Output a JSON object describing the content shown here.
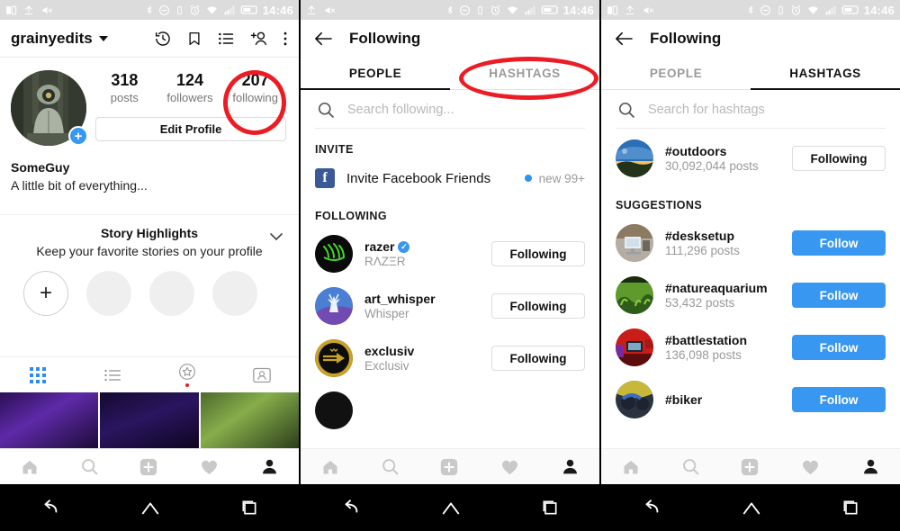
{
  "status_bar": {
    "time": "14:46",
    "icons": [
      "split-screen-icon",
      "upload-icon",
      "mute-icon",
      "bluetooth-icon",
      "dnd-icon",
      "vibrate-icon",
      "alarm-icon",
      "wifi-icon",
      "signal-icon",
      "battery-icon"
    ]
  },
  "panel1": {
    "header": {
      "username": "grainyedits",
      "icons": [
        "history-icon",
        "bookmark-icon",
        "list-icon",
        "add-person-icon",
        "more-vertical-icon"
      ]
    },
    "profile": {
      "avatar_alt": "profile-photo",
      "add_story_label": "+",
      "stats": [
        {
          "number": "318",
          "label": "posts"
        },
        {
          "number": "124",
          "label": "followers"
        },
        {
          "number": "207",
          "label": "following"
        }
      ],
      "edit_profile_label": "Edit Profile",
      "display_name": "SomeGuy",
      "bio": "A little bit of everything..."
    },
    "highlights": {
      "title": "Story Highlights",
      "subtitle": "Keep your favorite stories on your profile",
      "new_label": "+"
    },
    "tabs": [
      "grid-icon",
      "list-icon",
      "tagged-star-icon",
      "nametag-icon"
    ],
    "bottom_nav": [
      "home-icon",
      "search-icon",
      "add-post-icon",
      "heart-icon",
      "profile-icon"
    ],
    "annotation": "red-circle-around-following-count"
  },
  "panel2": {
    "header": {
      "back": "back-arrow-icon",
      "title": "Following"
    },
    "tabs": [
      {
        "label": "PEOPLE",
        "active": true
      },
      {
        "label": "HASHTAGS",
        "active": false
      }
    ],
    "search_placeholder": "Search following...",
    "invite_section": "INVITE",
    "invite_row": {
      "icon": "facebook-icon",
      "label": "Invite Facebook Friends",
      "badge": "new 99+"
    },
    "following_section": "FOLLOWING",
    "rows": [
      {
        "name": "razer",
        "verified": true,
        "sub": "RΛZΞR",
        "button": "Following",
        "style": "outline",
        "avatar": "av-razer"
      },
      {
        "name": "art_whisper",
        "verified": false,
        "sub": "Whisper",
        "button": "Following",
        "style": "outline",
        "avatar": "av-art"
      },
      {
        "name": "exclusiv",
        "verified": false,
        "sub": "Exclusiv",
        "button": "Following",
        "style": "outline",
        "avatar": "av-excl"
      }
    ],
    "bottom_nav": [
      "home-icon",
      "search-icon",
      "add-post-icon",
      "heart-icon",
      "profile-icon"
    ],
    "annotation": "red-ellipse-around-hashtags-tab"
  },
  "panel3": {
    "header": {
      "back": "back-arrow-icon",
      "title": "Following"
    },
    "tabs": [
      {
        "label": "PEOPLE",
        "active": false
      },
      {
        "label": "HASHTAGS",
        "active": true
      }
    ],
    "search_placeholder": "Search for hashtags",
    "rows_top": [
      {
        "name": "#outdoors",
        "sub": "30,092,044 posts",
        "button": "Following",
        "style": "outline",
        "avatar": "av-outdoors"
      }
    ],
    "suggestions_section": "SUGGESTIONS",
    "rows": [
      {
        "name": "#desksetup",
        "sub": "111,296 posts",
        "button": "Follow",
        "style": "filled",
        "avatar": "av-desk"
      },
      {
        "name": "#natureaquarium",
        "sub": "53,432 posts",
        "button": "Follow",
        "style": "filled",
        "avatar": "av-aqua"
      },
      {
        "name": "#battlestation",
        "sub": "136,098 posts",
        "button": "Follow",
        "style": "filled",
        "avatar": "av-battle"
      },
      {
        "name": "#biker",
        "sub": "",
        "button": "Follow",
        "style": "filled",
        "avatar": "av-biker"
      }
    ],
    "bottom_nav": [
      "home-icon",
      "search-icon",
      "add-post-icon",
      "heart-icon",
      "profile-icon"
    ]
  },
  "android_nav": [
    "back-nav-icon",
    "home-nav-icon",
    "recents-nav-icon"
  ],
  "colors": {
    "accent_blue": "#3897f0",
    "annotation_red": "#ec1c24",
    "facebook_blue": "#3b5998",
    "status_bar_bg": "#dcdcdc"
  }
}
